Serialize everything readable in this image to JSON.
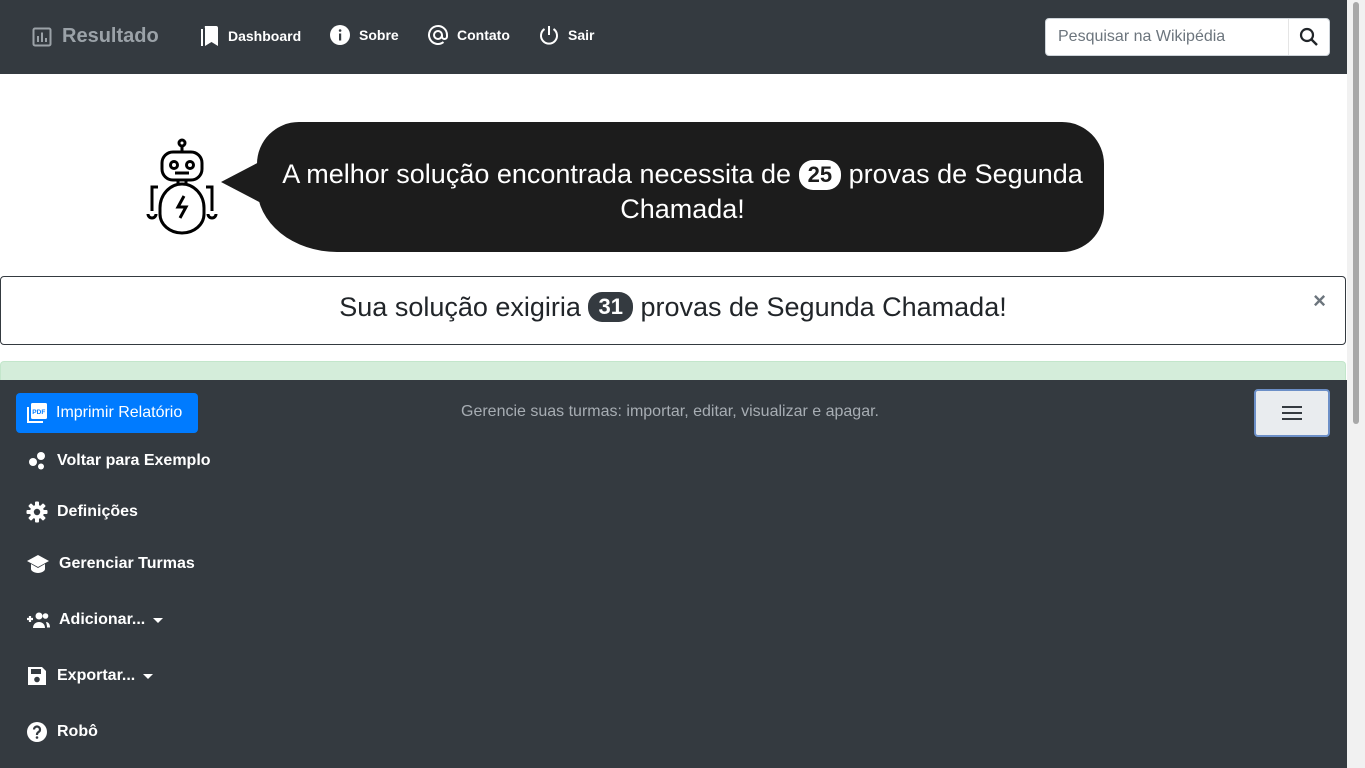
{
  "navbar": {
    "brand": "Resultado",
    "links": [
      "Dashboard",
      "Sobre",
      "Contato",
      "Sair"
    ],
    "search_placeholder": "Pesquisar na Wikipédia"
  },
  "bubble": {
    "text_before": "A melhor solução encontrada necessita de",
    "count": "25",
    "text_after": "provas de Segunda Chamada!"
  },
  "alert": {
    "text_before": "Sua solução exigiria",
    "count": "31",
    "text_after": "provas de Segunda Chamada!",
    "close": "×"
  },
  "panel": {
    "print_button": "Imprimir Relatório",
    "description": "Gerencie suas turmas: importar, editar, visualizar e apagar.",
    "menu": {
      "example": "Voltar para Exemplo",
      "settings": "Definições",
      "manage": "Gerenciar Turmas",
      "add": "Adicionar...",
      "export": "Exportar...",
      "robot": "Robô"
    }
  },
  "colors": {
    "navbar_bg": "#343a40",
    "primary": "#007bff",
    "bubble_bg": "#1c1c1c",
    "success_bg": "#d4edda"
  }
}
